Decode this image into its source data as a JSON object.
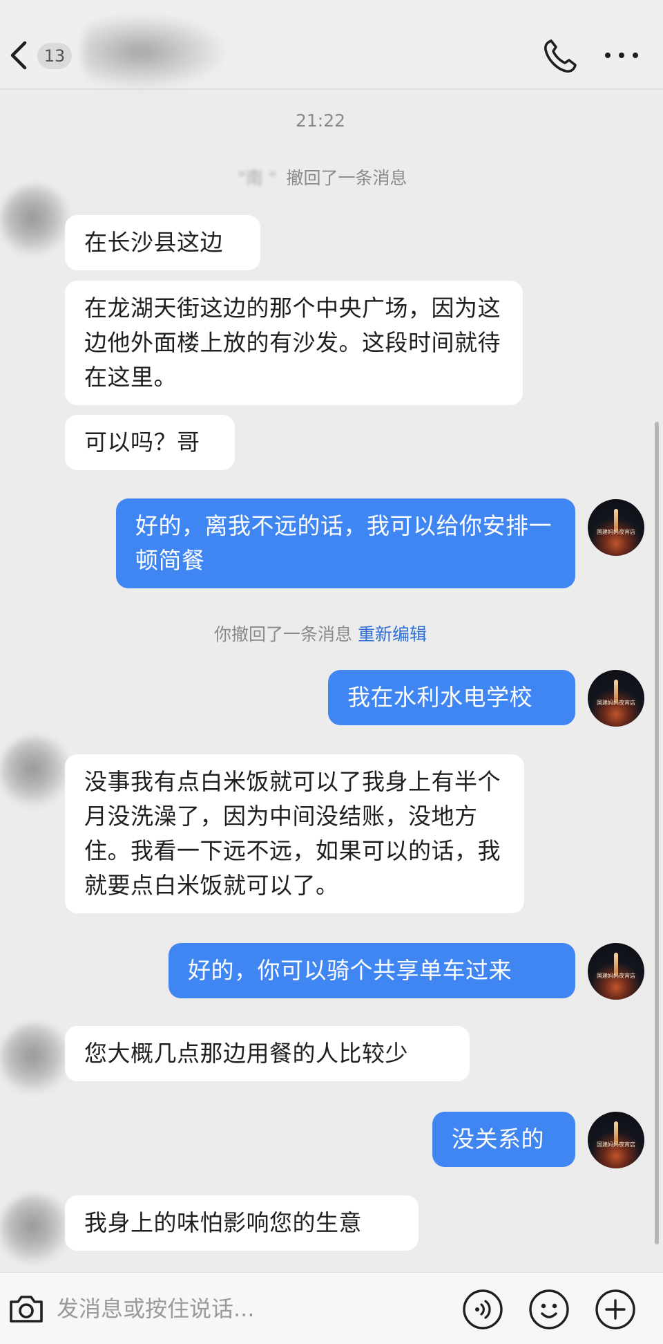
{
  "header": {
    "back_icon": "chevron-left-icon",
    "unread_count": "13",
    "contact_name": "",
    "call_icon": "phone-icon",
    "more_icon": "more-horizontal-icon"
  },
  "chat": {
    "timestamp": "21:22",
    "notice_1_name": "\"南 \"",
    "notice_1_text": " 撤回了一条消息",
    "notice_2_text": "你撤回了一条消息 ",
    "notice_2_link": "重新编辑",
    "messages": [
      {
        "side": "in",
        "text": "在长沙县这边"
      },
      {
        "side": "in",
        "text": "在龙湖天街这边的那个中央广场，因为这边他外面楼上放的有沙发。这段时间就待在这里。"
      },
      {
        "side": "in",
        "text": "可以吗？哥"
      },
      {
        "side": "out",
        "text": "好的，离我不远的话，我可以给你安排一顿简餐"
      },
      {
        "side": "out",
        "text": "我在水利水电学校"
      },
      {
        "side": "in",
        "text": "没事我有点白米饭就可以了我身上有半个月没洗澡了，因为中间没结账，没地方住。我看一下远不远，如果可以的话，我就要点白米饭就可以了。"
      },
      {
        "side": "out",
        "text": "好的，你可以骑个共享单车过来"
      },
      {
        "side": "in",
        "text": "您大概几点那边用餐的人比较少"
      },
      {
        "side": "out",
        "text": "没关系的"
      },
      {
        "side": "in",
        "text": "我身上的味怕影响您的生意"
      }
    ],
    "my_avatar_text": "国建妈妈夜宵店"
  },
  "input_bar": {
    "placeholder": "发消息或按住说话...",
    "camera_icon": "camera-icon",
    "voice_icon": "voice-icon",
    "emoji_icon": "emoji-icon",
    "plus_icon": "plus-icon"
  },
  "colors": {
    "outgoing_bubble": "#3f86f2",
    "incoming_bubble": "#ffffff",
    "background": "#ececec",
    "link": "#2f6fd6"
  }
}
